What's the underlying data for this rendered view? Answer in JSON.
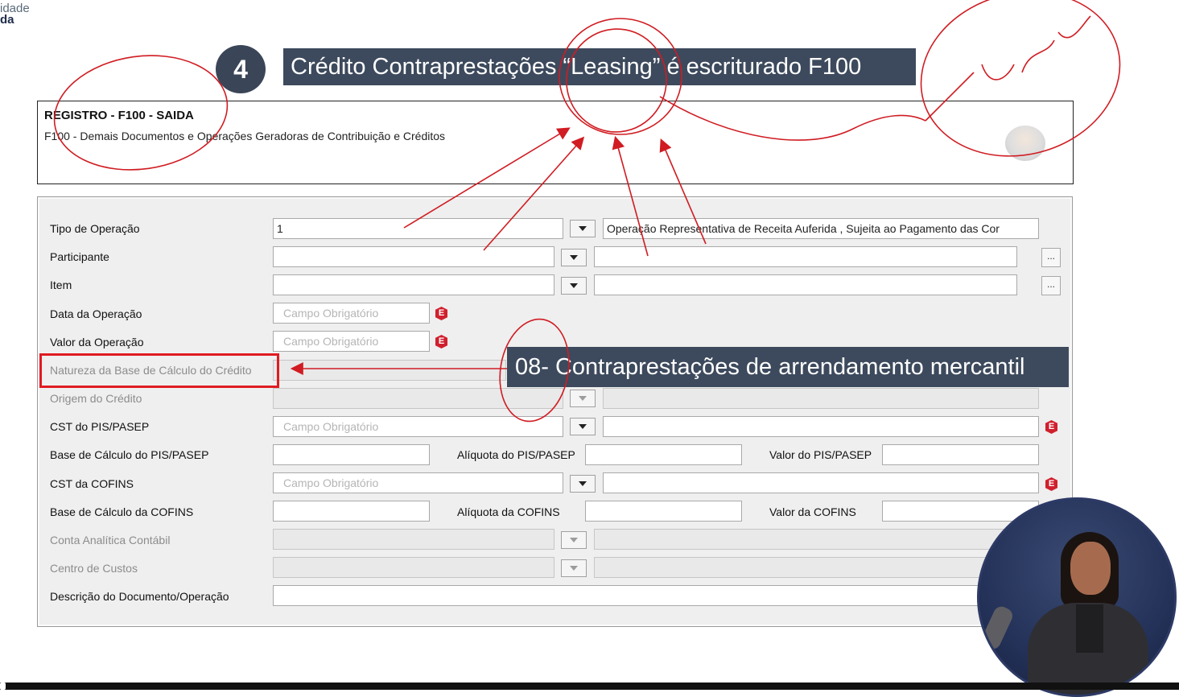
{
  "logo": {
    "line1": "idade",
    "line2": "da"
  },
  "slide": {
    "step_number": "4",
    "title": "Crédito Contraprestações “Leasing” é escriturado F100",
    "callout": "08- Contraprestações de arrendamento mercantil"
  },
  "register": {
    "title": "REGISTRO - F100 - SAIDA",
    "subtitle": "F100 - Demais Documentos e Operações Geradoras de Contribuição e Créditos"
  },
  "form": {
    "tipo_operacao": {
      "label": "Tipo de Operação",
      "value": "1",
      "description": "Operação Representativa de Receita Auferida , Sujeita  ao Pagamento das Cor"
    },
    "participante": {
      "label": "Participante",
      "button": "..."
    },
    "item": {
      "label": "Item",
      "button": "..."
    },
    "data_operacao": {
      "label": "Data da Operação",
      "placeholder": "Campo Obrigatório"
    },
    "valor_operacao": {
      "label": "Valor da Operação",
      "placeholder": "Campo Obrigatório"
    },
    "natureza_base": {
      "label": "Natureza da Base de Cálculo do Crédito"
    },
    "origem_credito": {
      "label": "Origem do Crédito"
    },
    "cst_pis": {
      "label": "CST do PIS/PASEP",
      "placeholder": "Campo Obrigatório"
    },
    "base_pis": {
      "label": "Base de Cálculo do PIS/PASEP"
    },
    "aliquota_pis": {
      "label": "Alíquota do PIS/PASEP"
    },
    "valor_pis": {
      "label": "Valor do PIS/PASEP"
    },
    "cst_cofins": {
      "label": "CST da COFINS",
      "placeholder": "Campo Obrigatório"
    },
    "base_cofins": {
      "label": "Base de Cálculo da COFINS"
    },
    "aliquota_cofins": {
      "label": "Alíquota da COFINS"
    },
    "valor_cofins": {
      "label": "Valor da COFINS"
    },
    "conta_analitica": {
      "label": "Conta Analítica Contábil"
    },
    "centro_custos": {
      "label": "Centro de Custos"
    },
    "descricao": {
      "label": "Descrição do Documento/Operação"
    }
  },
  "required_icon": "E",
  "annotation": {
    "handwriting": "Contábil",
    "color": "#d01c22"
  },
  "colors": {
    "banner": "#3d4a5d",
    "highlight": "#e01b22",
    "required": "#d0202e"
  }
}
